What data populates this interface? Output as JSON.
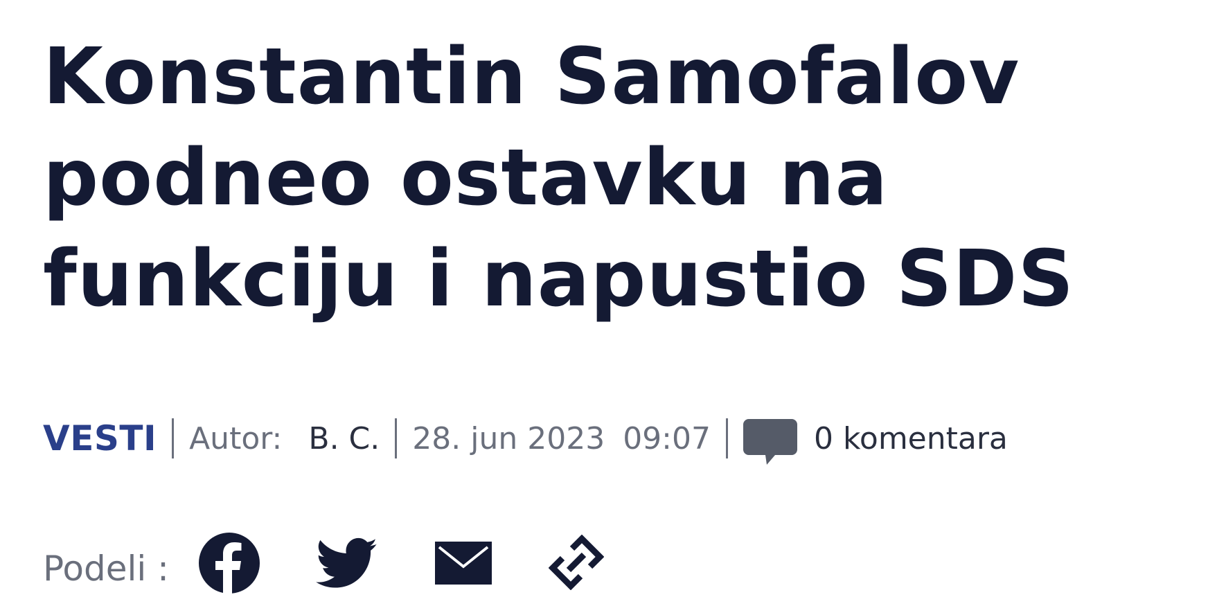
{
  "article": {
    "title_lines": [
      "Konstantin Samofalov",
      "podneo ostavku na",
      "funkciju i napustio SDS"
    ]
  },
  "meta": {
    "category": "VESTI",
    "author_label": "Autor:",
    "author": "B. C.",
    "date": "28. jun 2023",
    "time": "09:07",
    "comments": "0 komentara",
    "comment_icon": "comment-bubble-icon"
  },
  "share": {
    "label": "Podeli :",
    "icons": [
      "facebook-icon",
      "twitter-icon",
      "mail-icon",
      "link-icon"
    ]
  },
  "colors": {
    "headline": "#141a33",
    "category": "#2a3f8a",
    "muted": "#6a6f7c",
    "icon": "#141a33",
    "comment_icon": "#555b68"
  }
}
